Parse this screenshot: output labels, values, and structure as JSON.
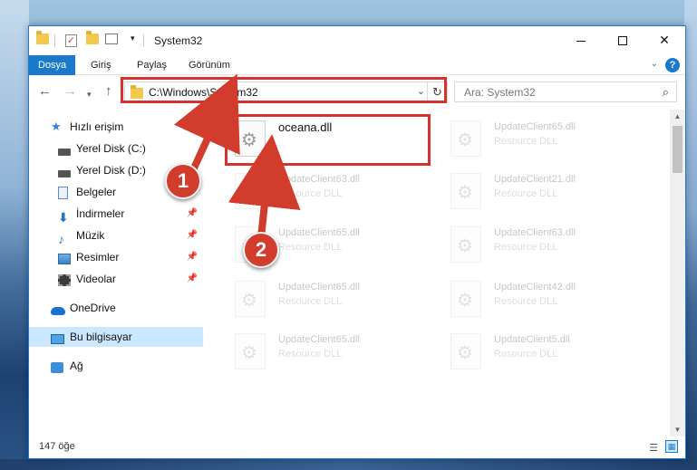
{
  "window": {
    "title": "System32"
  },
  "ribbon": {
    "tabs": [
      "Dosya",
      "Giriş",
      "Paylaş",
      "Görünüm"
    ],
    "active_tab": "Dosya",
    "help_label": "?"
  },
  "address": {
    "path": "C:\\Windows\\System32"
  },
  "search": {
    "placeholder": "Ara: System32"
  },
  "sidebar": {
    "items": [
      {
        "label": "Hızlı erişim",
        "icon": "star-icon",
        "pinned": false
      },
      {
        "label": "Yerel Disk (C:)",
        "icon": "disk-icon",
        "pinned": false
      },
      {
        "label": "Yerel Disk (D:)",
        "icon": "disk-icon",
        "pinned": false
      },
      {
        "label": "Belgeler",
        "icon": "document-icon",
        "pinned": false
      },
      {
        "label": "İndirmeler",
        "icon": "download-icon",
        "pinned": true
      },
      {
        "label": "Müzik",
        "icon": "music-icon",
        "pinned": true
      },
      {
        "label": "Resimler",
        "icon": "picture-icon",
        "pinned": true
      },
      {
        "label": "Videolar",
        "icon": "video-icon",
        "pinned": true
      },
      {
        "label": "OneDrive",
        "icon": "cloud-icon",
        "pinned": false
      },
      {
        "label": "Bu bilgisayar",
        "icon": "computer-icon",
        "pinned": false
      },
      {
        "label": "Ağ",
        "icon": "network-icon",
        "pinned": false
      }
    ],
    "selected": "Bu bilgisayar"
  },
  "files": {
    "main": {
      "name": "oceana.dll"
    },
    "items": [
      {
        "name": "UpdateClient65.dll",
        "type": "Resource DLL"
      },
      {
        "name": "UpdateClient63.dll",
        "type": "Resource DLL"
      },
      {
        "name": "UpdateClient21.dll",
        "type": "Resource DLL"
      },
      {
        "name": "UpdateClient65.dll",
        "type": "Resource DLL"
      },
      {
        "name": "UpdateClient63.dll",
        "type": "Resource DLL"
      },
      {
        "name": "UpdateClient65.dll",
        "type": "Resource DLL"
      },
      {
        "name": "UpdateClient42.dll",
        "type": "Resource DLL"
      },
      {
        "name": "UpdateClient65.dll",
        "type": "Resource DLL"
      },
      {
        "name": "UpdateClient5.dll",
        "type": "Resource DLL"
      }
    ]
  },
  "status": {
    "count": "147 öğe"
  },
  "callouts": {
    "step1": "1",
    "step2": "2"
  },
  "colors": {
    "accent": "#1979ca",
    "highlight": "#d6312d",
    "callout": "#d13c2c"
  }
}
